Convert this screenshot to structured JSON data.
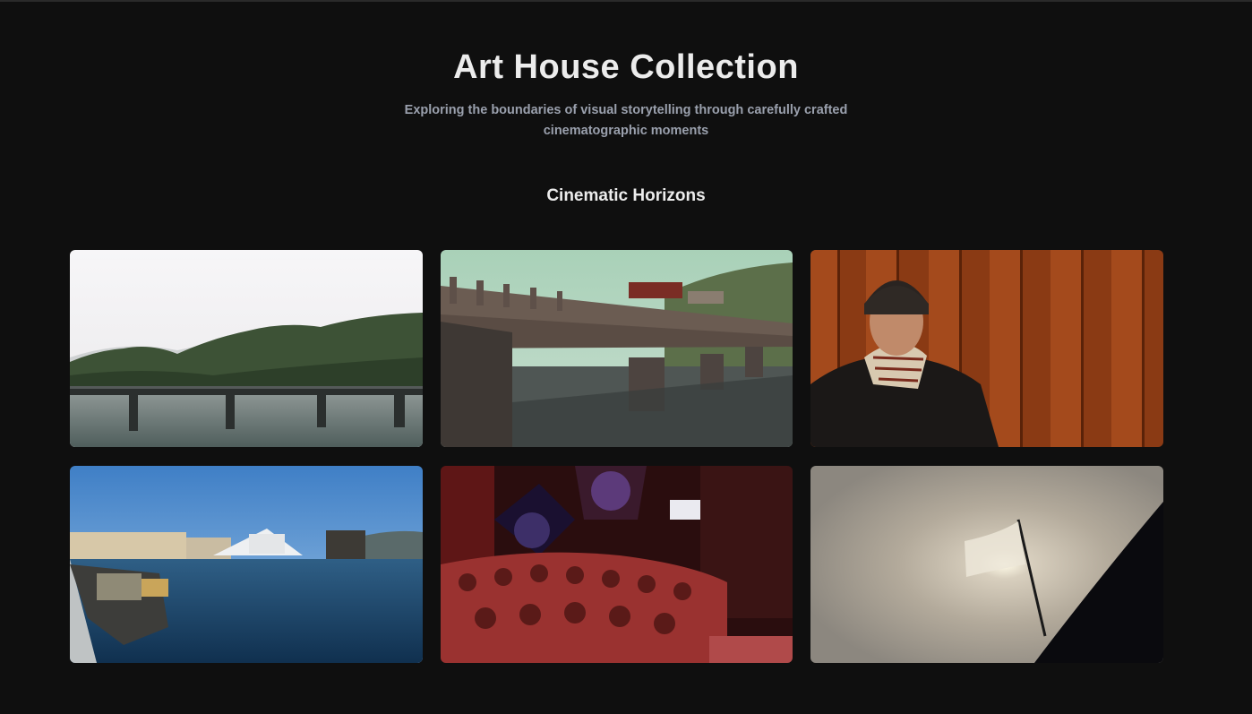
{
  "header": {
    "title": "Art House Collection",
    "subtitle": "Exploring the boundaries of visual storytelling through carefully crafted cinematographic moments"
  },
  "section": {
    "title": "Cinematic Horizons"
  },
  "gallery": {
    "items": [
      {
        "scene": "misty-lake-bridge"
      },
      {
        "scene": "railway-bridge-reflection"
      },
      {
        "scene": "man-with-scarf-wooden-wall"
      },
      {
        "scene": "harbor-city-waterfront"
      },
      {
        "scene": "stage-crowd-performance"
      },
      {
        "scene": "flag-silhouette-sun"
      }
    ]
  }
}
